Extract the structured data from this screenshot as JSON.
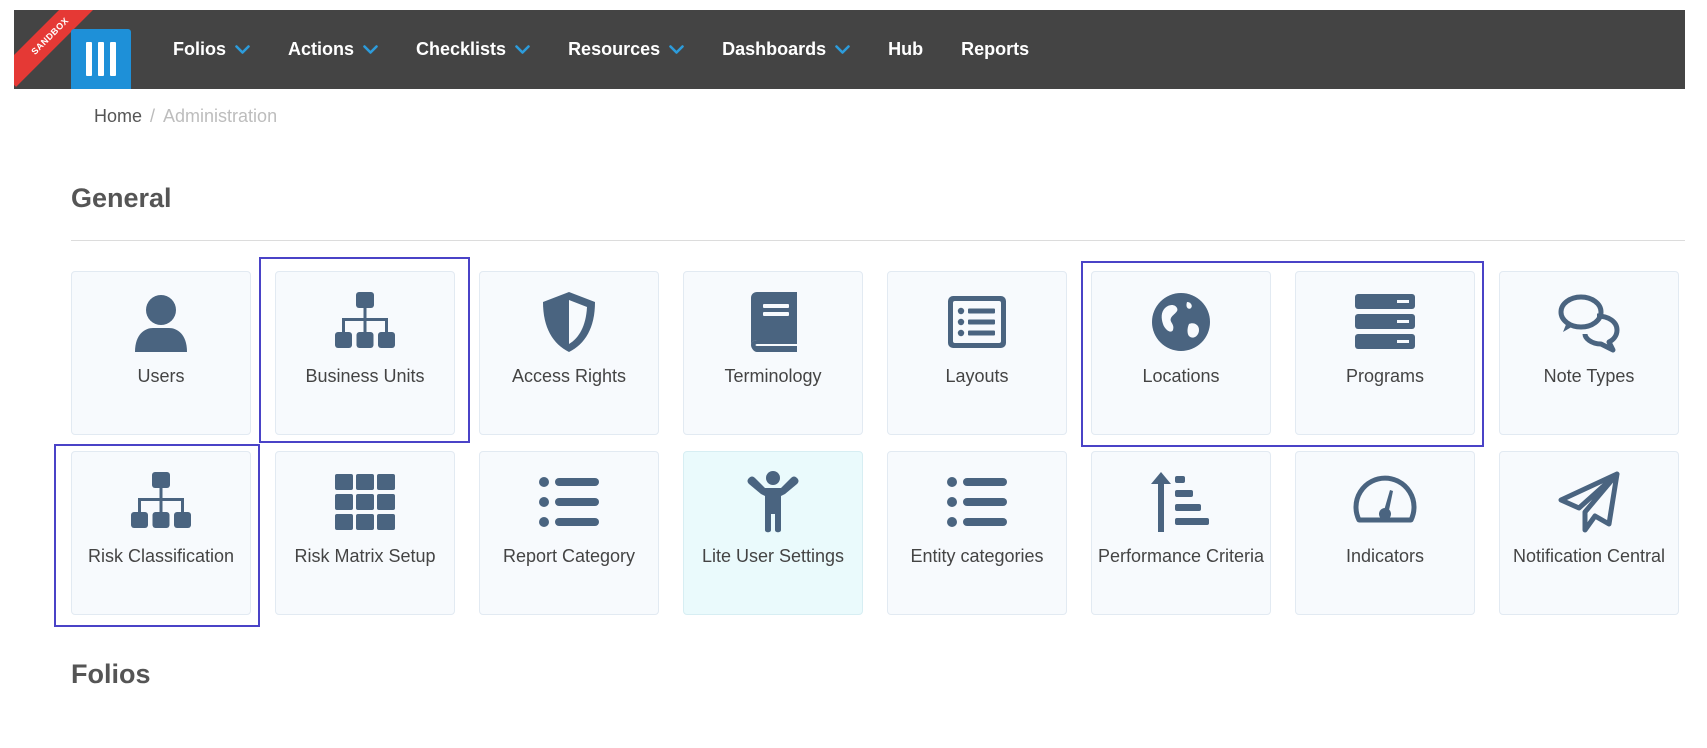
{
  "header": {
    "ribbon": "SANDBOX",
    "nav": [
      {
        "label": "Folios",
        "has_dropdown": true
      },
      {
        "label": "Actions",
        "has_dropdown": true
      },
      {
        "label": "Checklists",
        "has_dropdown": true
      },
      {
        "label": "Resources",
        "has_dropdown": true
      },
      {
        "label": "Dashboards",
        "has_dropdown": true
      },
      {
        "label": "Hub",
        "has_dropdown": false
      },
      {
        "label": "Reports",
        "has_dropdown": false
      }
    ]
  },
  "breadcrumb": {
    "home": "Home",
    "separator": "/",
    "current": "Administration"
  },
  "sections": {
    "general": "General",
    "folios": "Folios"
  },
  "tiles": [
    {
      "label": "Users",
      "icon": "user-icon"
    },
    {
      "label": "Business Units",
      "icon": "org-chart-icon"
    },
    {
      "label": "Access Rights",
      "icon": "shield-icon"
    },
    {
      "label": "Terminology",
      "icon": "book-icon"
    },
    {
      "label": "Layouts",
      "icon": "list-alt-icon"
    },
    {
      "label": "Locations",
      "icon": "globe-icon"
    },
    {
      "label": "Programs",
      "icon": "server-icon"
    },
    {
      "label": "Note Types",
      "icon": "comments-icon"
    },
    {
      "label": "Risk Classification",
      "icon": "org-chart-icon"
    },
    {
      "label": "Risk Matrix Setup",
      "icon": "grid-icon"
    },
    {
      "label": "Report Category",
      "icon": "list-icon"
    },
    {
      "label": "Lite User Settings",
      "icon": "child-icon",
      "active": true
    },
    {
      "label": "Entity categories",
      "icon": "list-icon"
    },
    {
      "label": "Performance Criteria",
      "icon": "sort-amount-icon"
    },
    {
      "label": "Indicators",
      "icon": "gauge-icon"
    },
    {
      "label": "Notification Central",
      "icon": "paper-plane-icon"
    }
  ],
  "colors": {
    "nav_bg": "#444444",
    "logo": "#1e90d8",
    "icon": "#4a6480",
    "highlight": "#4a43c7",
    "ribbon": "#e53935"
  }
}
